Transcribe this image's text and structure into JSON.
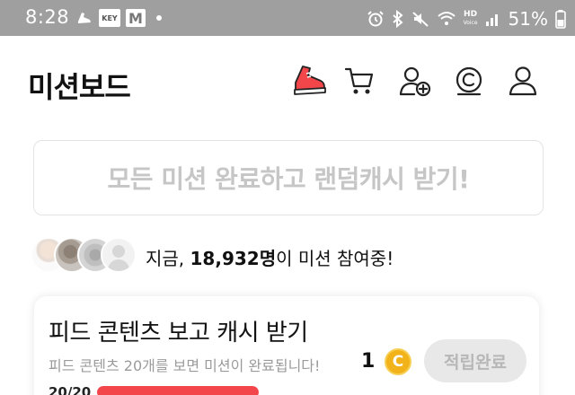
{
  "status_bar": {
    "time": "8:28",
    "badge_key": "KEY",
    "badge_m": "M",
    "hd_label": "HD",
    "voice_label": "Voice",
    "battery_text": "51%"
  },
  "header": {
    "title": "미션보드",
    "icons": [
      "sneaker-icon",
      "cart-icon",
      "add-friend-icon",
      "cash-icon",
      "profile-icon"
    ]
  },
  "banner": {
    "text": "모든 미션 완료하고 랜덤캐시 받기!"
  },
  "participants": {
    "prefix": "지금, ",
    "count": "18,932명",
    "suffix": "이 미션 참여중!"
  },
  "mission": {
    "title": "피드 콘텐츠 보고 캐시 받기",
    "description": "피드 콘텐츠 20개를 보면 미션이 완료됩니다!",
    "reward": "1",
    "coin_symbol": "C",
    "button_label": "적립완료",
    "progress_text": "20/20",
    "progress_ratio": 1.0
  },
  "colors": {
    "accent_red": "#f2464b",
    "coin_gold": "#f2b31a",
    "status_bar_bg": "#9f9f9f"
  }
}
